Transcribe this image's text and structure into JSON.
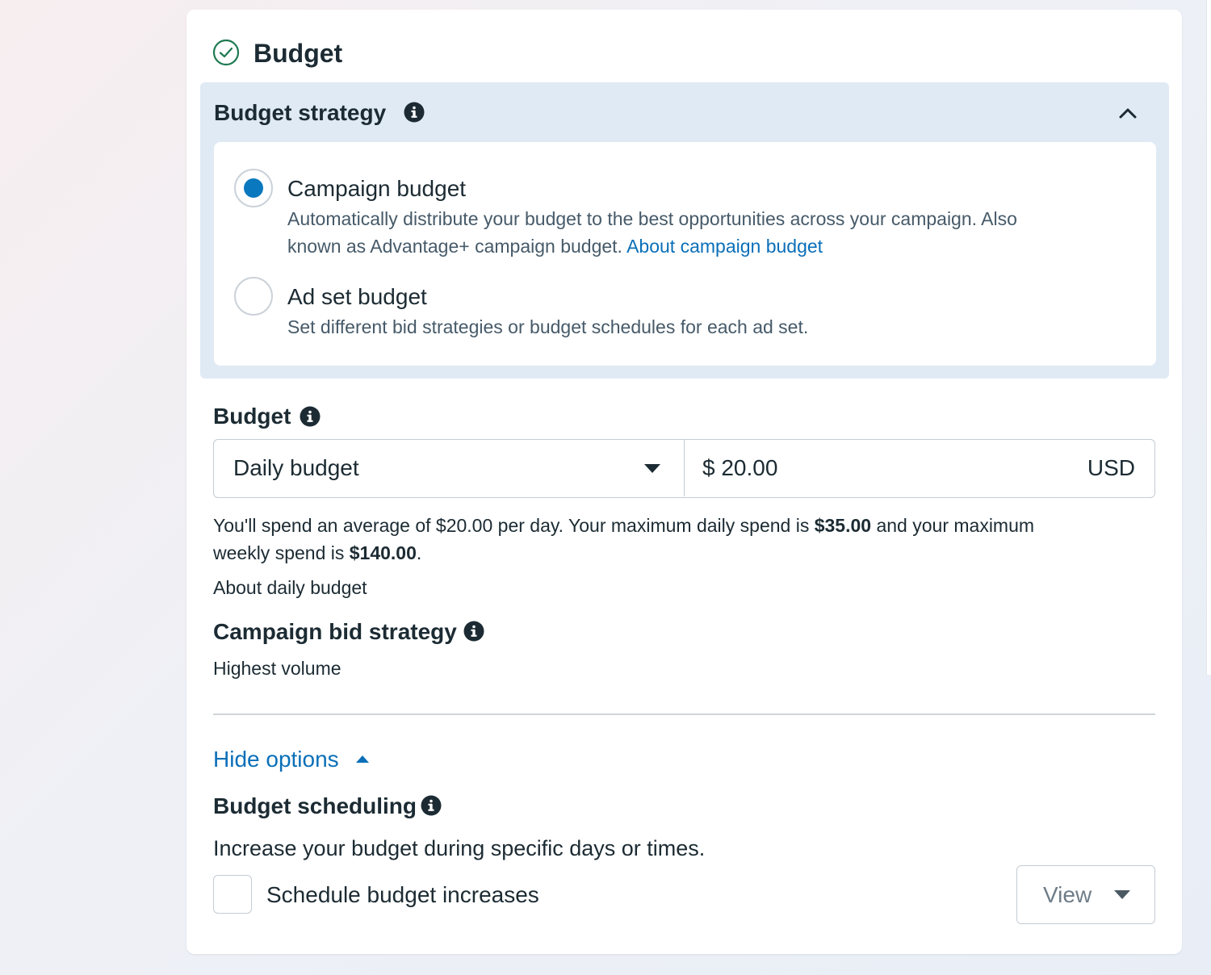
{
  "card": {
    "title": "Budget",
    "title_icon": "check-circle-icon"
  },
  "strategy": {
    "title": "Budget strategy",
    "options": [
      {
        "label": "Campaign budget",
        "selected": true,
        "desc_line1": "Automatically distribute your budget to the best opportunities across your campaign. Also",
        "desc_line2": "known as Advantage+ campaign budget.",
        "link": "About campaign budget"
      },
      {
        "label": "Ad set budget",
        "selected": false,
        "desc_line1": "Set different bid strategies or budget schedules for each ad set."
      }
    ]
  },
  "budget": {
    "title": "Budget",
    "type_selected": "Daily budget",
    "amount": "$ 20.00",
    "currency": "USD",
    "summary_line1_a": "You'll spend an average of $20.00 per day. Your maximum daily spend is ",
    "summary_max_daily": "$35.00",
    "summary_line1_b": " and your maximum",
    "summary_line2_a": "weekly spend is ",
    "summary_max_weekly": "$140.00",
    "summary_line2_b": ".",
    "link": "About daily budget"
  },
  "bid_strategy": {
    "title": "Campaign bid strategy",
    "value": "Highest volume"
  },
  "options_toggle": {
    "label": "Hide options"
  },
  "scheduling": {
    "title": "Budget scheduling",
    "description": "Increase your budget during specific days or times.",
    "checkbox_label": "Schedule budget increases",
    "checked": false,
    "view_button": "View"
  },
  "colors": {
    "accent": "#0a78be",
    "link": "#0a6fb8",
    "panel_bg": "#dfeaf4",
    "success": "#1e7a52"
  }
}
